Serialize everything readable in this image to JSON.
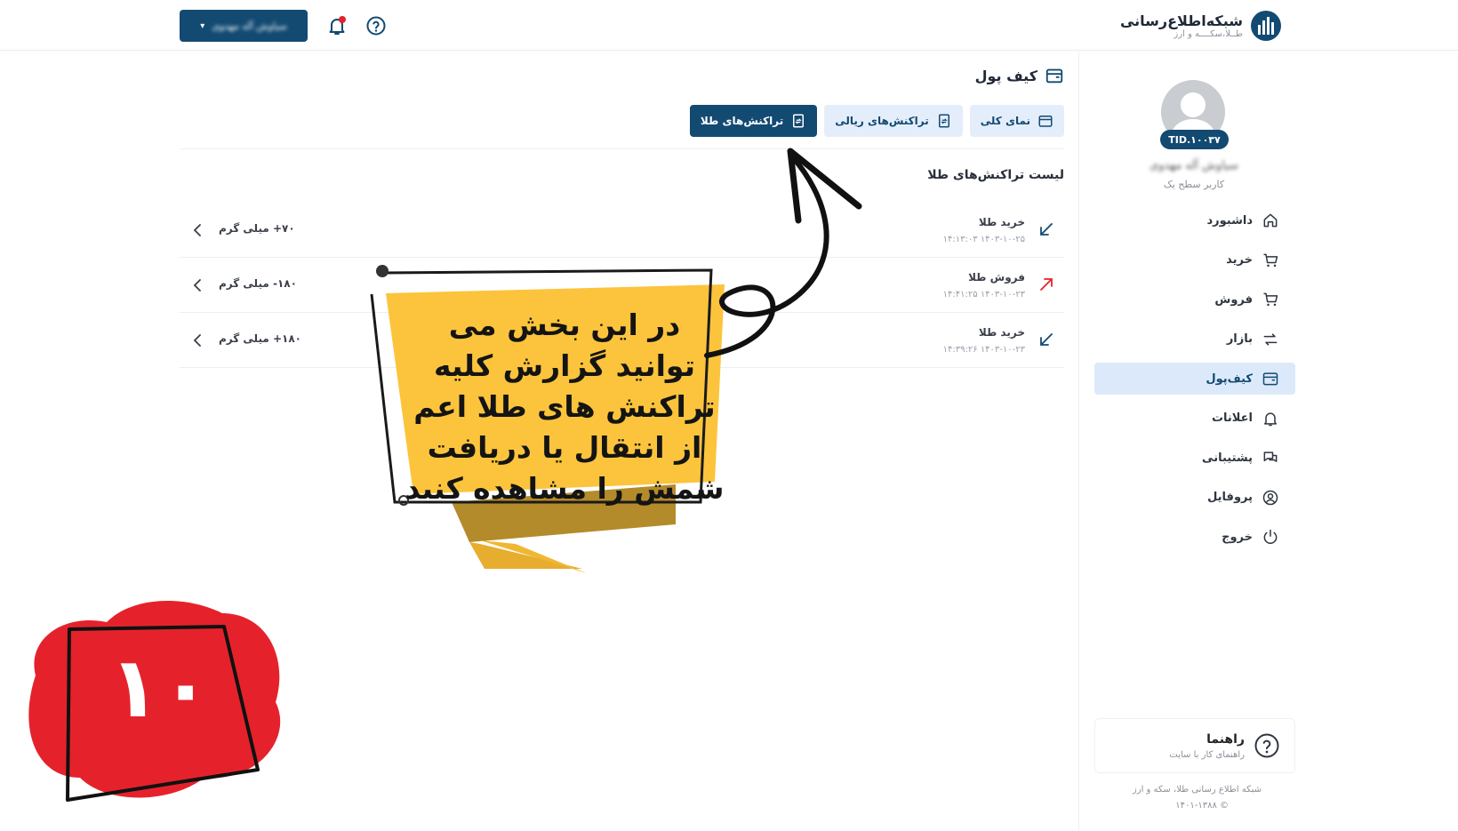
{
  "header": {
    "brand_title": "شبکه‌اطلاع‌رسانی",
    "brand_subtitle": "طــلا،سکــــه و ارز",
    "user_button_label": "سیاوش آله مهدوی"
  },
  "sidebar": {
    "user_id": "TID.۱۰۰۳۷",
    "user_name": "سیاوش آله مهدوی",
    "user_level": "کاربر سطح یک",
    "items": [
      {
        "label": "داشبورد",
        "icon": "home-icon"
      },
      {
        "label": "خرید",
        "icon": "cart-icon"
      },
      {
        "label": "فروش",
        "icon": "cart-icon"
      },
      {
        "label": "بازار",
        "icon": "exchange-icon"
      },
      {
        "label": "کیف‌پول",
        "icon": "wallet-icon",
        "active": true
      },
      {
        "label": "اعلانات",
        "icon": "bell-icon"
      },
      {
        "label": "پشتیبانی",
        "icon": "chat-icon"
      },
      {
        "label": "پروفایل",
        "icon": "user-circle-icon"
      },
      {
        "label": "خروج",
        "icon": "power-icon"
      }
    ],
    "help_title": "راهنما",
    "help_subtitle": "راهنمای کار با سایت",
    "footer_line1": "شبکه اطلاع رسانی طلا، سکه و ارز",
    "footer_line2": "© ۱۴۰۱-۱۳۸۸"
  },
  "main": {
    "title": "کیف پول",
    "tabs": [
      {
        "label": "نمای کلی",
        "active": false
      },
      {
        "label": "تراکنش‌های ریالی",
        "active": false
      },
      {
        "label": "تراکنش‌های طلا",
        "active": true
      }
    ],
    "list_title": "لیست تراکنش‌های طلا",
    "transactions": [
      {
        "title": "خرید طلا",
        "date": "۱۴۰۳-۱۰-۲۵ ۱۴:۱۳:۰۳",
        "amount": "۷۰+ میلی گرم",
        "direction": "in"
      },
      {
        "title": "فروش طلا",
        "date": "۱۴۰۳-۱۰-۲۳ ۱۴:۴۱:۲۵",
        "amount": "۱۸۰- میلی گرم",
        "direction": "out"
      },
      {
        "title": "خرید طلا",
        "date": "۱۴۰۳-۱۰-۲۳ ۱۴:۳۹:۲۶",
        "amount": "۱۸۰+ میلی گرم",
        "direction": "in"
      }
    ]
  },
  "annotation": {
    "banner_text": "در این بخش می توانید گزارش کلیه تراکنش های طلا اعم از انتقال یا دریافت شمش را مشاهده کنید",
    "step_number": "۱۰"
  },
  "colors": {
    "primary": "#124a72",
    "active_bg": "#dce9fa",
    "banner_yellow": "#fcc43c",
    "badge_red": "#e5222b"
  }
}
